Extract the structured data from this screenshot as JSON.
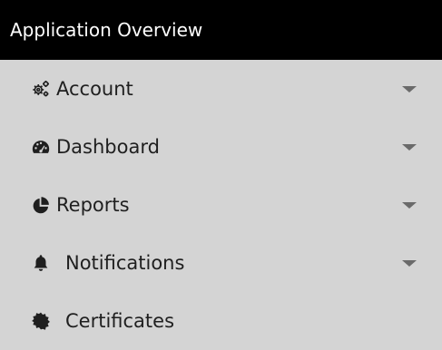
{
  "panel": {
    "title": "Application Overview"
  },
  "menu": {
    "items": [
      {
        "label": "Account",
        "icon": "cogs-icon",
        "has_dropdown": true
      },
      {
        "label": "Dashboard",
        "icon": "tachometer-icon",
        "has_dropdown": true
      },
      {
        "label": "Reports",
        "icon": "pie-chart-icon",
        "has_dropdown": true
      },
      {
        "label": "Notifications",
        "icon": "bell-icon",
        "has_dropdown": true
      },
      {
        "label": "Certificates",
        "icon": "certificate-icon",
        "has_dropdown": false
      }
    ]
  },
  "colors": {
    "header_background": "#000000",
    "header_text": "#ffffff",
    "panel_background": "#d4d4d4",
    "item_text": "#1f1f1f",
    "caret": "#6a6a6a"
  }
}
